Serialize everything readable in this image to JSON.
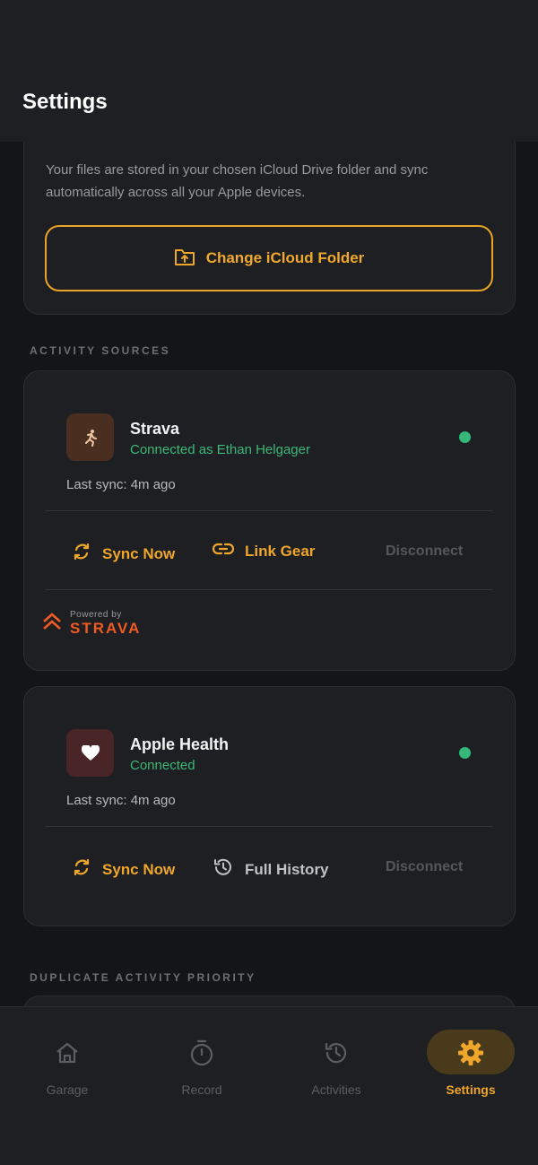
{
  "header": {
    "title": "Settings"
  },
  "icloud": {
    "description": "Your files are stored in your chosen iCloud Drive folder and sync automatically across all your Apple devices.",
    "change_folder_label": "Change iCloud Folder"
  },
  "sections": {
    "activity_sources": "ACTIVITY SOURCES",
    "duplicate_priority": "DUPLICATE ACTIVITY PRIORITY"
  },
  "strava": {
    "name": "Strava",
    "status": "Connected as Ethan Helgager",
    "last_sync": "Last sync: 4m ago",
    "sync_label": "Sync Now",
    "link_gear_label": "Link Gear",
    "disconnect_label": "Disconnect",
    "powered_by": "Powered by",
    "powered_brand": "STRAVA"
  },
  "apple_health": {
    "name": "Apple Health",
    "status": "Connected",
    "last_sync": "Last sync: 4m ago",
    "sync_label": "Sync Now",
    "full_history_label": "Full History",
    "disconnect_label": "Disconnect"
  },
  "tabs": [
    {
      "label": "Garage",
      "icon": "home-icon"
    },
    {
      "label": "Record",
      "icon": "stopwatch-icon"
    },
    {
      "label": "Activities",
      "icon": "history-icon"
    },
    {
      "label": "Settings",
      "icon": "gear-icon",
      "active": true
    }
  ],
  "colors": {
    "accent": "#efa62a",
    "connected": "#3cb878",
    "strava_brand": "#f05a22",
    "background": "#141518",
    "card": "#1d1f22"
  }
}
